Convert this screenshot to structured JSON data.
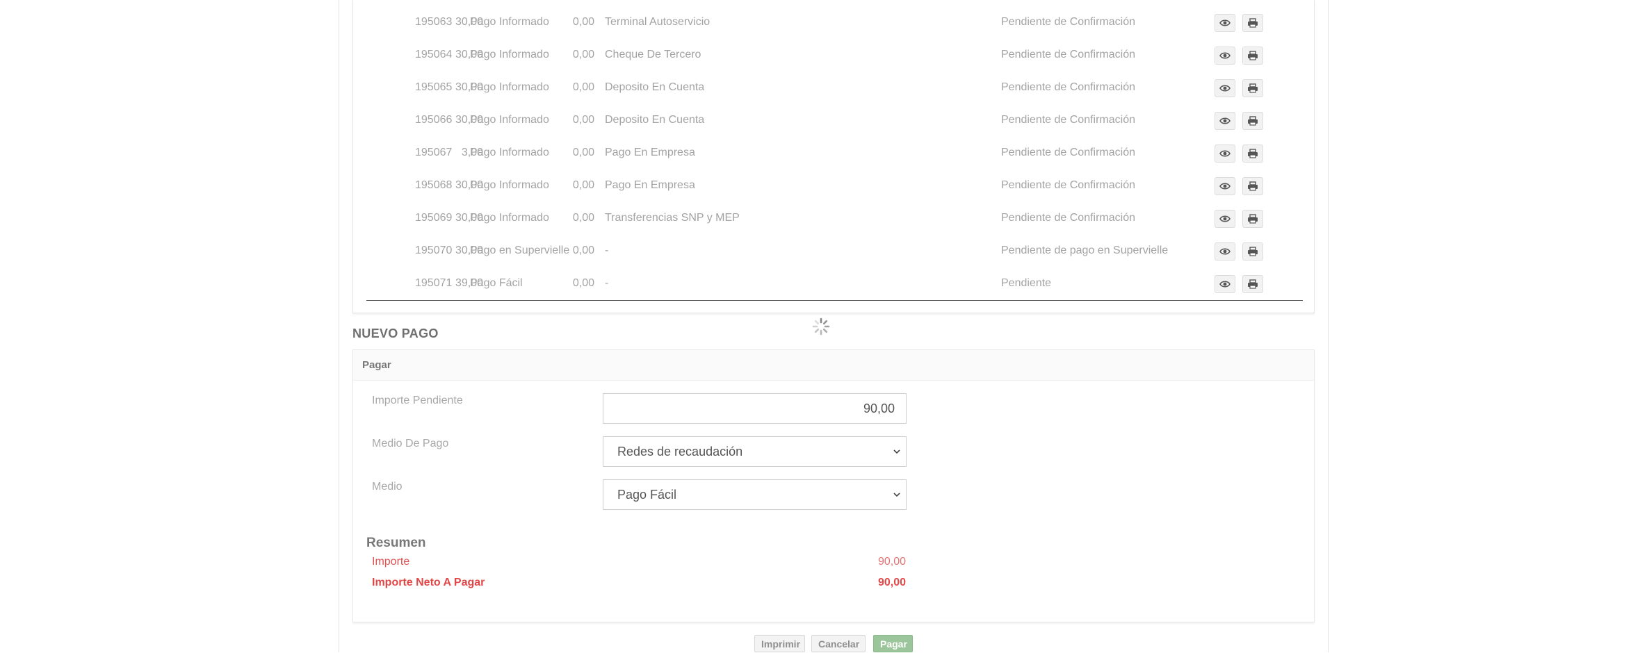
{
  "payments": {
    "rows": [
      {
        "id": "195063",
        "type": "Pago Informado",
        "medio": "Terminal Autoservicio",
        "importe": "30,00",
        "descuento": "0,00",
        "estado": "Pendiente de Confirmación"
      },
      {
        "id": "195064",
        "type": "Pago Informado",
        "medio": "Cheque De Tercero",
        "importe": "30,00",
        "descuento": "0,00",
        "estado": "Pendiente de Confirmación"
      },
      {
        "id": "195065",
        "type": "Pago Informado",
        "medio": "Deposito En Cuenta",
        "importe": "30,00",
        "descuento": "0,00",
        "estado": "Pendiente de Confirmación"
      },
      {
        "id": "195066",
        "type": "Pago Informado",
        "medio": "Deposito En Cuenta",
        "importe": "30,00",
        "descuento": "0,00",
        "estado": "Pendiente de Confirmación"
      },
      {
        "id": "195067",
        "type": "Pago Informado",
        "medio": "Pago En Empresa",
        "importe": "3,00",
        "descuento": "0,00",
        "estado": "Pendiente de Confirmación"
      },
      {
        "id": "195068",
        "type": "Pago Informado",
        "medio": "Pago En Empresa",
        "importe": "30,00",
        "descuento": "0,00",
        "estado": "Pendiente de Confirmación"
      },
      {
        "id": "195069",
        "type": "Pago Informado",
        "medio": "Transferencias SNP y MEP",
        "importe": "30,00",
        "descuento": "0,00",
        "estado": "Pendiente de Confirmación"
      },
      {
        "id": "195070",
        "type": "Pago en Supervielle",
        "medio": "-",
        "importe": "30,00",
        "descuento": "0,00",
        "estado": "Pendiente de pago en Supervielle"
      },
      {
        "id": "195071",
        "type": "Pago Fácil",
        "medio": "-",
        "importe": "39,00",
        "descuento": "0,00",
        "estado": "Pendiente"
      }
    ],
    "row_icons": {
      "view": "eye-icon",
      "print": "printer-icon"
    }
  },
  "loading_icon": "spinner-icon",
  "nuevo_pago": {
    "title": "NUEVO PAGO",
    "panel_title": "Pagar",
    "fields": {
      "importe_pendiente": {
        "label": "Importe Pendiente",
        "value": "90,00"
      },
      "medio_de_pago": {
        "label": "Medio De Pago",
        "selected": "Redes de recaudación"
      },
      "medio": {
        "label": "Medio",
        "selected": "Pago Fácil"
      }
    },
    "resumen": {
      "title": "Resumen",
      "importe_label": "Importe",
      "importe_value": "90,00",
      "neto_label": "Importe Neto A Pagar",
      "neto_value": "90,00"
    }
  },
  "actions": {
    "imprimir": "Imprimir",
    "cancelar": "Cancelar",
    "pagar": "Pagar"
  },
  "colors": {
    "accent_red": "#e04848",
    "pay_button": "#9bc59a"
  }
}
